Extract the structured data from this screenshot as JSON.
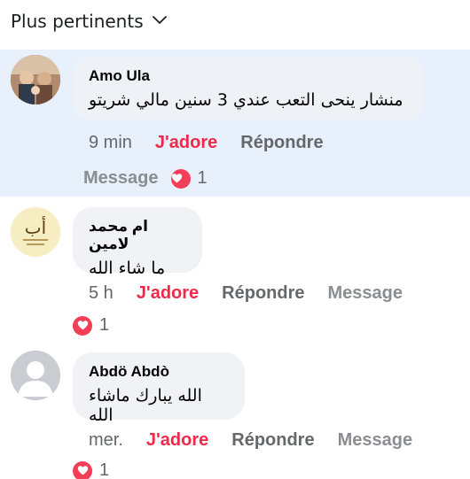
{
  "sort": {
    "label": "Plus pertinents",
    "icon": "chevron-down-icon"
  },
  "colors": {
    "like": "#f02849",
    "heart": "#f33e58",
    "highlight_bg": "#e8f0fb",
    "bubble_bg": "#f0f2f5"
  },
  "comments": [
    {
      "author": "Amo Ula",
      "text": "منشار ينحى التعب عندي 3 سنين مالي شريتو",
      "time": "9 min",
      "like_label": "J'adore",
      "reply_label": "Répondre",
      "message_label": "Message",
      "reaction_count": "1",
      "reaction_icon": "heart-icon"
    },
    {
      "author": "ام محمد لامين",
      "text": "ما شاء الله",
      "time": "5 h",
      "like_label": "J'adore",
      "reply_label": "Répondre",
      "message_label": "Message",
      "reaction_count": "1",
      "reaction_icon": "heart-icon"
    },
    {
      "author": "Abdö Abdò",
      "text": "الله يبارك ماشاء الله",
      "time": "mer.",
      "like_label": "J'adore",
      "reply_label": "Répondre",
      "message_label": "Message",
      "reaction_count": "1",
      "reaction_icon": "heart-icon"
    }
  ]
}
